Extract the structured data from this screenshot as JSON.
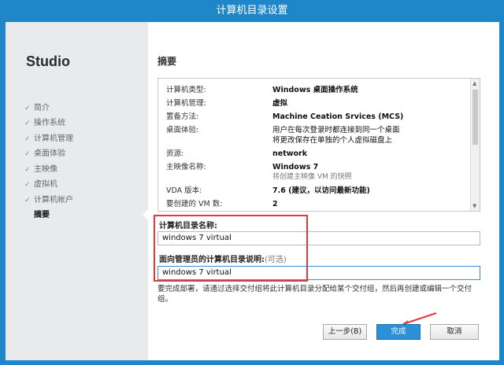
{
  "window": {
    "title": "计算机目录设置"
  },
  "sidebar": {
    "product": "Studio",
    "steps": [
      {
        "label": "简介",
        "done": true
      },
      {
        "label": "操作系统",
        "done": true
      },
      {
        "label": "计算机管理",
        "done": true
      },
      {
        "label": "桌面体验",
        "done": true
      },
      {
        "label": "主映像",
        "done": true
      },
      {
        "label": "虚拟机",
        "done": true
      },
      {
        "label": "计算机帐户",
        "done": true
      },
      {
        "label": "摘要",
        "done": false,
        "current": true
      }
    ]
  },
  "main": {
    "heading": "摘要",
    "summary": [
      {
        "label": "计算机类型:",
        "value": "Windows 桌面操作系统"
      },
      {
        "label": "计算机管理:",
        "value": "虚拟"
      },
      {
        "label": "置备方法:",
        "value": "Machine Ceation Srvices (MCS)"
      },
      {
        "label": "桌面体验:",
        "value": "用户在每次登录时都连接到同一个桌面",
        "value2": "将更改保存在单独的个人虚拟磁盘上"
      },
      {
        "label": "资源:",
        "value": "network"
      },
      {
        "label": "主映像名称:",
        "value": "Windows 7",
        "sub": "将创建主映像 VM 的快照"
      },
      {
        "label": "VDA 版本:",
        "value": "7.6 (建议，以访问最新功能)"
      },
      {
        "label": "要创建的 VM 数:",
        "value": "2"
      }
    ],
    "catalog_name_label": "计算机目录名称:",
    "catalog_name_value": "windows 7 virtual",
    "catalog_desc_label": "面向管理员的计算机目录说明:",
    "catalog_desc_optional": "(可选)",
    "catalog_desc_value": "windows 7 virtual",
    "note": "要完成部署，请通过选择交付组将此计算机目录分配给某个交付组，然后再创建或编辑一个交付组。"
  },
  "buttons": {
    "back": "上一步(B)",
    "finish": "完成",
    "cancel": "取消"
  },
  "colors": {
    "title_bar": "#1f87c9",
    "highlight": "#e23a3a",
    "primary_button": "#2c90d8"
  }
}
